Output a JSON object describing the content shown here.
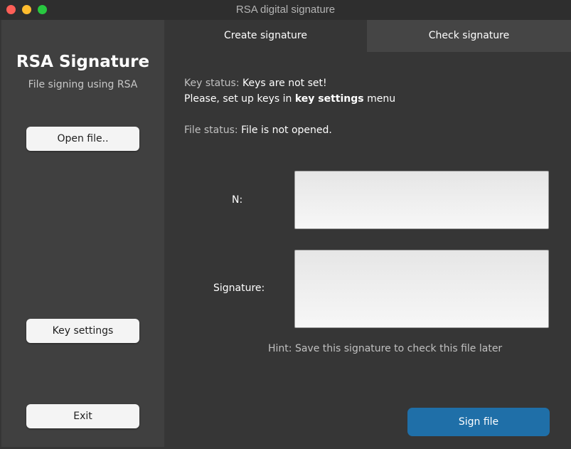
{
  "window": {
    "title": "RSA digital signature"
  },
  "sidebar": {
    "title": "RSA Signature",
    "subtitle": "File signing using RSA",
    "open_file_label": "Open file..",
    "key_settings_label": "Key settings",
    "exit_label": "Exit"
  },
  "tabs": [
    {
      "label": "Create signature",
      "active": true
    },
    {
      "label": "Check signature",
      "active": false
    }
  ],
  "main": {
    "key_status_label": "Key status:",
    "key_status_value": "Keys are not set!",
    "key_hint_prefix": "Please, set up keys in",
    "key_hint_bold": "key settings",
    "key_hint_suffix": "menu",
    "file_status_label": "File status:",
    "file_status_value": "File is not opened.",
    "n_label": "N:",
    "n_value": "",
    "signature_label": "Signature:",
    "signature_value": "",
    "hint": "Hint: Save this signature to check this file later",
    "sign_button_label": "Sign file"
  },
  "colors": {
    "accent": "#1f6fa8",
    "sidebar_bg": "#404040",
    "main_bg": "#363636"
  }
}
